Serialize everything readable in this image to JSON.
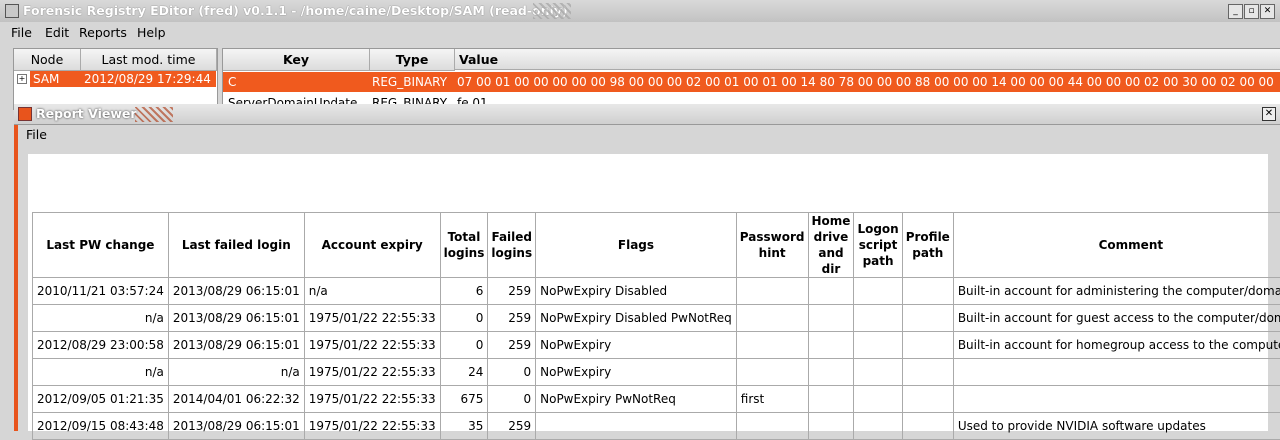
{
  "main_window": {
    "title": "Forensic Registry EDitor (fred) v0.1.1 - /home/caine/Desktop/SAM (read-only)"
  },
  "menu": {
    "file": "File",
    "edit": "Edit",
    "reports": "Reports",
    "help": "Help"
  },
  "tree": {
    "col_node": "Node",
    "col_time": "Last mod. time",
    "rows": [
      {
        "name": "SAM",
        "time": "2012/08/29 17:29:44",
        "selected": true
      }
    ]
  },
  "values": {
    "col_key": "Key",
    "col_type": "Type",
    "col_value": "Value",
    "rows": [
      {
        "key": "C",
        "type": "REG_BINARY",
        "value": "07 00 01 00 00 00 00 00 98 00 00 00 02 00 01 00 01 00 14 80 78 00 00 00 88 00 00 00 14 00 00 00 44 00 00 00 02 00 30 00 02 00 00",
        "selected": true
      },
      {
        "key": "ServerDomainUpdate",
        "type": "REG_BINARY",
        "value": "fe 01",
        "selected": false
      }
    ]
  },
  "report_viewer": {
    "title": "Report Viewer",
    "menu_file": "File",
    "headers": {
      "last_pw_change": "Last PW change",
      "last_failed_login": "Last failed login",
      "account_expiry": "Account expiry",
      "total_logins": "Total logins",
      "failed_logins": "Failed logins",
      "flags": "Flags",
      "password_hint": "Password hint",
      "home_drive": "Home drive and dir",
      "logon_script": "Logon script path",
      "profile_path": "Profile path",
      "comment": "Comment"
    },
    "rows": [
      {
        "last_pw_change": "2010/11/21 03:57:24",
        "last_failed_login": "2013/08/29 06:15:01",
        "account_expiry": "n/a",
        "total_logins": "6",
        "failed_logins": "259",
        "flags": "NoPwExpiry Disabled",
        "password_hint": "",
        "home_drive": "",
        "logon_script": "",
        "profile_path": "",
        "comment": "Built-in account for administering the computer/domain"
      },
      {
        "last_pw_change": "n/a",
        "last_failed_login": "2013/08/29 06:15:01",
        "account_expiry": "1975/01/22 22:55:33",
        "total_logins": "0",
        "failed_logins": "259",
        "flags": "NoPwExpiry Disabled PwNotReq",
        "password_hint": "",
        "home_drive": "",
        "logon_script": "",
        "profile_path": "",
        "comment": "Built-in account for guest access to the computer/domain"
      },
      {
        "last_pw_change": "2012/08/29 23:00:58",
        "last_failed_login": "2013/08/29 06:15:01",
        "account_expiry": "1975/01/22 22:55:33",
        "total_logins": "0",
        "failed_logins": "259",
        "flags": "NoPwExpiry",
        "password_hint": "",
        "home_drive": "",
        "logon_script": "",
        "profile_path": "",
        "comment": "Built-in account for homegroup access to the computer"
      },
      {
        "last_pw_change": "n/a",
        "last_failed_login": "n/a",
        "account_expiry": "1975/01/22 22:55:33",
        "total_logins": "24",
        "failed_logins": "0",
        "flags": "NoPwExpiry",
        "password_hint": "",
        "home_drive": "",
        "logon_script": "",
        "profile_path": "",
        "comment": ""
      },
      {
        "last_pw_change": "2012/09/05 01:21:35",
        "last_failed_login": "2014/04/01 06:22:32",
        "account_expiry": "1975/01/22 22:55:33",
        "total_logins": "675",
        "failed_logins": "0",
        "flags": "NoPwExpiry PwNotReq",
        "password_hint": "first",
        "home_drive": "",
        "logon_script": "",
        "profile_path": "",
        "comment": ""
      },
      {
        "last_pw_change": "2012/09/15 08:43:48",
        "last_failed_login": "2013/08/29 06:15:01",
        "account_expiry": "1975/01/22 22:55:33",
        "total_logins": "35",
        "failed_logins": "259",
        "flags": "",
        "password_hint": "",
        "home_drive": "",
        "logon_script": "",
        "profile_path": "",
        "comment": "Used to provide NVIDIA software updates"
      }
    ]
  }
}
